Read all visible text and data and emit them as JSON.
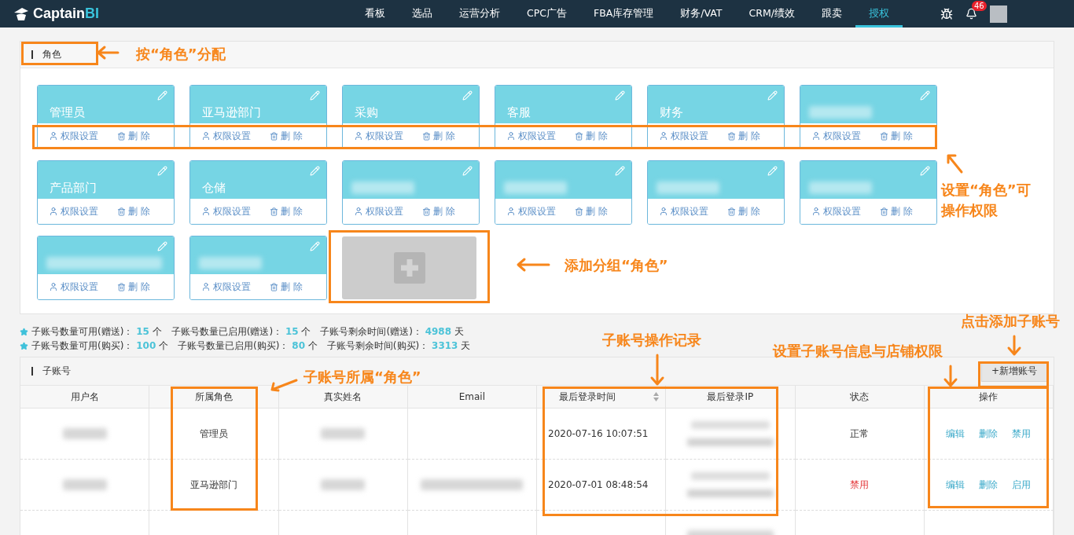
{
  "nav": {
    "logo_main": "Captain",
    "logo_accent": "BI",
    "notification_count": "46",
    "items": [
      {
        "label": "看板",
        "selected": false
      },
      {
        "label": "选品",
        "selected": false
      },
      {
        "label": "运营分析",
        "selected": false
      },
      {
        "label": "CPC广告",
        "selected": false
      },
      {
        "label": "FBA库存管理",
        "selected": false
      },
      {
        "label": "财务/VAT",
        "selected": false
      },
      {
        "label": "CRM/绩效",
        "selected": false
      },
      {
        "label": "跟卖",
        "selected": false
      },
      {
        "label": "授权",
        "selected": true
      }
    ]
  },
  "roles": {
    "title": "角色",
    "cards": [
      {
        "kind": "named",
        "name": "管理员",
        "permission_label": "权限设置",
        "delete_label": "删 除"
      },
      {
        "kind": "named",
        "name": "亚马逊部门",
        "permission_label": "权限设置",
        "delete_label": "删 除"
      },
      {
        "kind": "named",
        "name": "采购",
        "permission_label": "权限设置",
        "delete_label": "删 除"
      },
      {
        "kind": "named",
        "name": "客服",
        "permission_label": "权限设置",
        "delete_label": "删 除"
      },
      {
        "kind": "named",
        "name": "财务",
        "permission_label": "权限设置",
        "delete_label": "删 除"
      },
      {
        "kind": "redacted",
        "permission_label": "权限设置",
        "delete_label": "删 除"
      },
      {
        "kind": "named",
        "name": "产品部门",
        "permission_label": "权限设置",
        "delete_label": "删 除"
      },
      {
        "kind": "named",
        "name": "仓储",
        "permission_label": "权限设置",
        "delete_label": "删 除"
      },
      {
        "kind": "redacted",
        "permission_label": "权限设置",
        "delete_label": "删 除"
      },
      {
        "kind": "redacted",
        "permission_label": "权限设置",
        "delete_label": "删 除"
      },
      {
        "kind": "redacted",
        "permission_label": "权限设置",
        "delete_label": "删 除"
      },
      {
        "kind": "redacted",
        "permission_label": "权限设置",
        "delete_label": "删 除"
      },
      {
        "kind": "redacted",
        "permission_label": "权限设置",
        "delete_label": "删 除"
      },
      {
        "kind": "redacted",
        "permission_label": "权限设置",
        "delete_label": "删 除"
      }
    ]
  },
  "quota": [
    {
      "items": [
        {
          "label": "子账号数量可用(赠送)：",
          "value": "15",
          "unit": "个"
        },
        {
          "label": "子账号数量已启用(赠送)：",
          "value": "15",
          "unit": "个"
        },
        {
          "label": "子账号剩余时间(赠送)：",
          "value": "4988",
          "unit": "天"
        }
      ]
    },
    {
      "items": [
        {
          "label": "子账号数量可用(购买)：",
          "value": "100",
          "unit": "个"
        },
        {
          "label": "子账号数量已启用(购买)：",
          "value": "80",
          "unit": "个"
        },
        {
          "label": "子账号剩余时间(购买)：",
          "value": "3313",
          "unit": "天"
        }
      ]
    }
  ],
  "accounts": {
    "title": "子账号",
    "add_button": "+新增账号",
    "columns": [
      {
        "label": "用户名",
        "sortable": false
      },
      {
        "label": "所属角色",
        "sortable": false
      },
      {
        "label": "真实姓名",
        "sortable": false
      },
      {
        "label": "Email",
        "sortable": false
      },
      {
        "label": "最后登录时间",
        "sortable": true
      },
      {
        "label": "最后登录IP",
        "sortable": false
      },
      {
        "label": "状态",
        "sortable": false
      },
      {
        "label": "操作",
        "sortable": false
      }
    ],
    "rows": [
      {
        "cells": [
          {
            "kind": "redacted"
          },
          {
            "kind": "text",
            "text": "管理员"
          },
          {
            "kind": "redacted"
          },
          {
            "kind": "empty"
          },
          {
            "kind": "time",
            "text": "2020-07-16 10:07:51"
          },
          {
            "kind": "redacted_pair"
          },
          {
            "kind": "status",
            "text": "正常",
            "enabled": true
          },
          {
            "kind": "actions",
            "links": [
              "编辑",
              "删除",
              "禁用"
            ]
          }
        ]
      },
      {
        "cells": [
          {
            "kind": "redacted"
          },
          {
            "kind": "text",
            "text": "亚马逊部门"
          },
          {
            "kind": "redacted"
          },
          {
            "kind": "redacted_long"
          },
          {
            "kind": "time",
            "text": "2020-07-01 08:48:54"
          },
          {
            "kind": "redacted_pair"
          },
          {
            "kind": "status",
            "text": "禁用",
            "enabled": false
          },
          {
            "kind": "actions",
            "links": [
              "编辑",
              "删除",
              "启用"
            ]
          }
        ]
      },
      {
        "cells": [
          {
            "kind": "empty"
          },
          {
            "kind": "empty"
          },
          {
            "kind": "empty"
          },
          {
            "kind": "empty"
          },
          {
            "kind": "empty"
          },
          {
            "kind": "redacted"
          },
          {
            "kind": "empty"
          },
          {
            "kind": "empty"
          }
        ]
      }
    ]
  },
  "annotations": [
    {
      "text": "按“角色”分配"
    },
    {
      "text": "设置“角色”可操作权限"
    },
    {
      "text": "添加分组“角色”"
    },
    {
      "text": "子账号所属“角色”"
    },
    {
      "text": "子账号操作记录"
    },
    {
      "text": "设置子账号信息与店铺权限"
    },
    {
      "text": "点击添加子账号"
    }
  ]
}
